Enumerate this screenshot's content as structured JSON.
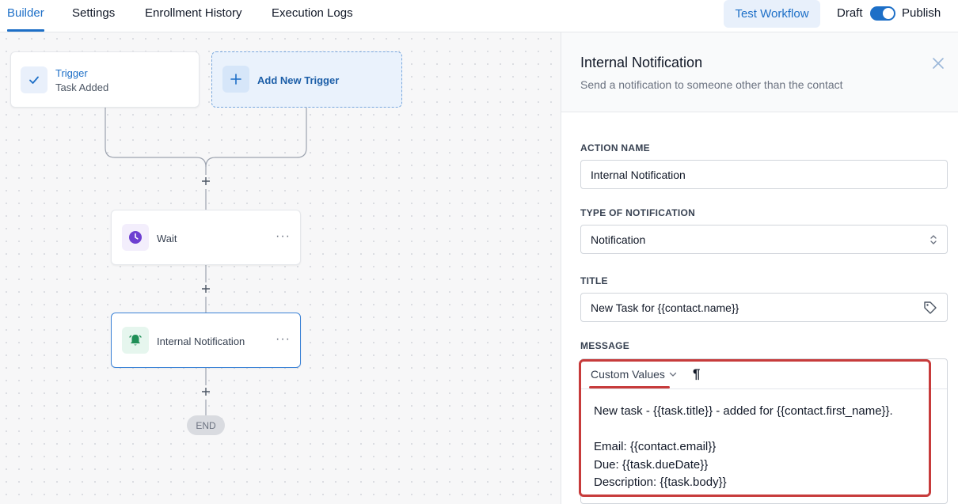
{
  "nav": {
    "tabs": [
      {
        "label": "Builder",
        "active": true
      },
      {
        "label": "Settings",
        "active": false
      },
      {
        "label": "Enrollment History",
        "active": false
      },
      {
        "label": "Execution Logs",
        "active": false
      }
    ],
    "test_workflow_label": "Test Workflow",
    "draft_label": "Draft",
    "publish_label": "Publish",
    "publish_toggle_on": true
  },
  "canvas": {
    "trigger": {
      "title": "Trigger",
      "subtitle": "Task Added",
      "icon": "check-icon"
    },
    "add_trigger": {
      "label": "Add New Trigger",
      "icon": "plus-icon"
    },
    "steps": [
      {
        "label": "Wait",
        "icon": "clock-icon"
      },
      {
        "label": "Internal Notification",
        "icon": "bell-icon"
      }
    ],
    "end_label": "END"
  },
  "panel": {
    "title": "Internal Notification",
    "subtitle": "Send a notification to someone other than the contact",
    "action_name": {
      "label": "ACTION NAME",
      "value": "Internal Notification"
    },
    "type_of_notification": {
      "label": "TYPE OF NOTIFICATION",
      "value": "Notification"
    },
    "title_field": {
      "label": "TITLE",
      "value": "New Task for {{contact.name}}"
    },
    "message": {
      "label": "MESSAGE",
      "custom_values_label": "Custom Values",
      "paragraph_symbol": "¶",
      "lines": [
        "New task - {{task.title}} - added for {{contact.first_name}}.",
        "",
        "Email: {{contact.email}}",
        "Due: {{task.dueDate}}",
        "Description: {{task.body}}"
      ]
    }
  },
  "colors": {
    "accent": "#1d6fc7",
    "annotation": "#c73b3b",
    "wait_icon": "#6d3fd1",
    "bell_icon": "#1f8f57"
  }
}
